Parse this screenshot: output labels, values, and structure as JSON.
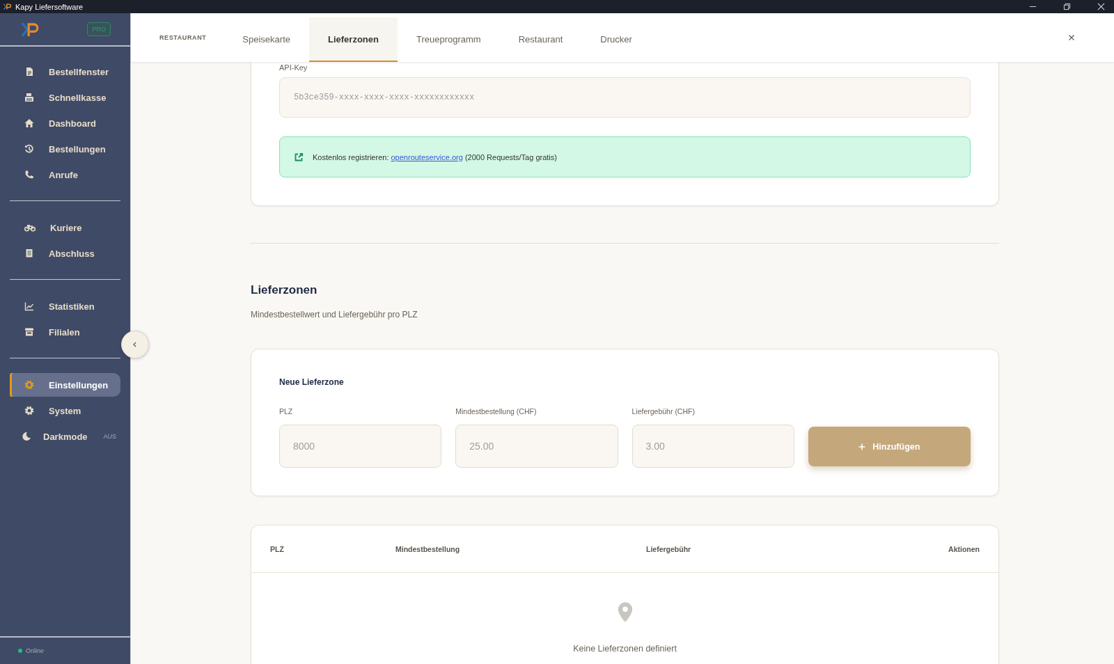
{
  "window": {
    "title": "Kapy Liefersoftware"
  },
  "sidebar": {
    "badge": "PRO",
    "groups": [
      [
        {
          "label": "Bestellfenster",
          "selected": false
        },
        {
          "label": "Schnellkasse",
          "selected": false
        },
        {
          "label": "Dashboard",
          "selected": false
        },
        {
          "label": "Bestellungen",
          "selected": false
        },
        {
          "label": "Anrufe",
          "selected": false
        }
      ],
      [
        {
          "label": "Kuriere",
          "selected": false
        },
        {
          "label": "Abschluss",
          "selected": false
        }
      ],
      [
        {
          "label": "Statistiken",
          "selected": false
        },
        {
          "label": "Filialen",
          "selected": false
        }
      ],
      [
        {
          "label": "Einstellungen",
          "selected": true
        },
        {
          "label": "System",
          "selected": false
        }
      ]
    ],
    "darkmode": {
      "label": "Darkmode",
      "value": "AUS"
    },
    "status": "Online"
  },
  "header": {
    "section": "RESTAURANT",
    "tabs": [
      {
        "label": "Speisekarte",
        "selected": false
      },
      {
        "label": "Lieferzonen",
        "selected": true
      },
      {
        "label": "Treueprogramm",
        "selected": false
      },
      {
        "label": "Restaurant",
        "selected": false
      },
      {
        "label": "Drucker",
        "selected": false
      }
    ]
  },
  "api_key": {
    "label": "API-Key",
    "placeholder": "5b3ce359-xxxx-xxxx-xxxx-xxxxxxxxxxxx"
  },
  "info": {
    "before": "Kostenlos registrieren: ",
    "link": "openrouteservice.org",
    "after": " (2000 Requests/Tag gratis)"
  },
  "zones": {
    "title": "Lieferzonen",
    "subtitle": "Mindestbestellwert und Liefergebühr pro PLZ",
    "form": {
      "title": "Neue Lieferzone",
      "fields": [
        {
          "label": "PLZ",
          "placeholder": "8000"
        },
        {
          "label": "Mindestbestellung (CHF)",
          "placeholder": "25.00"
        },
        {
          "label": "Liefergebühr (CHF)",
          "placeholder": "3.00"
        }
      ],
      "button": "Hinzufügen"
    },
    "table": {
      "columns": [
        "PLZ",
        "Mindestbestellung",
        "Liefergebühr",
        "Aktionen"
      ],
      "empty": "Keine Lieferzonen definiert"
    }
  }
}
